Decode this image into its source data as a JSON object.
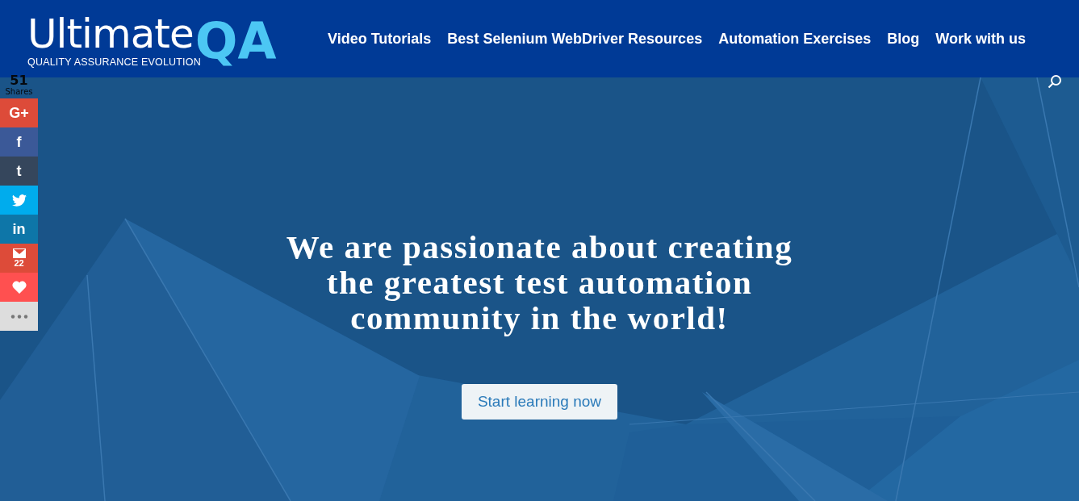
{
  "logo": {
    "word": "Ultimate",
    "accent": "QA",
    "tagline": "QUALITY ASSURANCE EVOLUTION"
  },
  "nav": [
    "Video Tutorials",
    "Best Selenium WebDriver Resources",
    "Automation Exercises",
    "Blog",
    "Work with us"
  ],
  "share": {
    "count": "51",
    "label": "Shares",
    "items": [
      {
        "kind": "letters",
        "label": "G+",
        "color": "#dd4b39"
      },
      {
        "kind": "letters",
        "label": "f",
        "color": "#3b5998"
      },
      {
        "kind": "letters",
        "label": "t",
        "color": "#35465c"
      },
      {
        "kind": "twitter",
        "color": "#00aced"
      },
      {
        "kind": "letters",
        "label": "in",
        "color": "#0e76a8"
      },
      {
        "kind": "mail",
        "count": "22",
        "color": "#dd4b39"
      },
      {
        "kind": "heart",
        "color": "#ff5050"
      },
      {
        "kind": "more",
        "color": "#dddddd"
      }
    ]
  },
  "hero": {
    "headline": "We are passionate about creating the greatest test automation community in the world!",
    "button": "Start learning now"
  }
}
